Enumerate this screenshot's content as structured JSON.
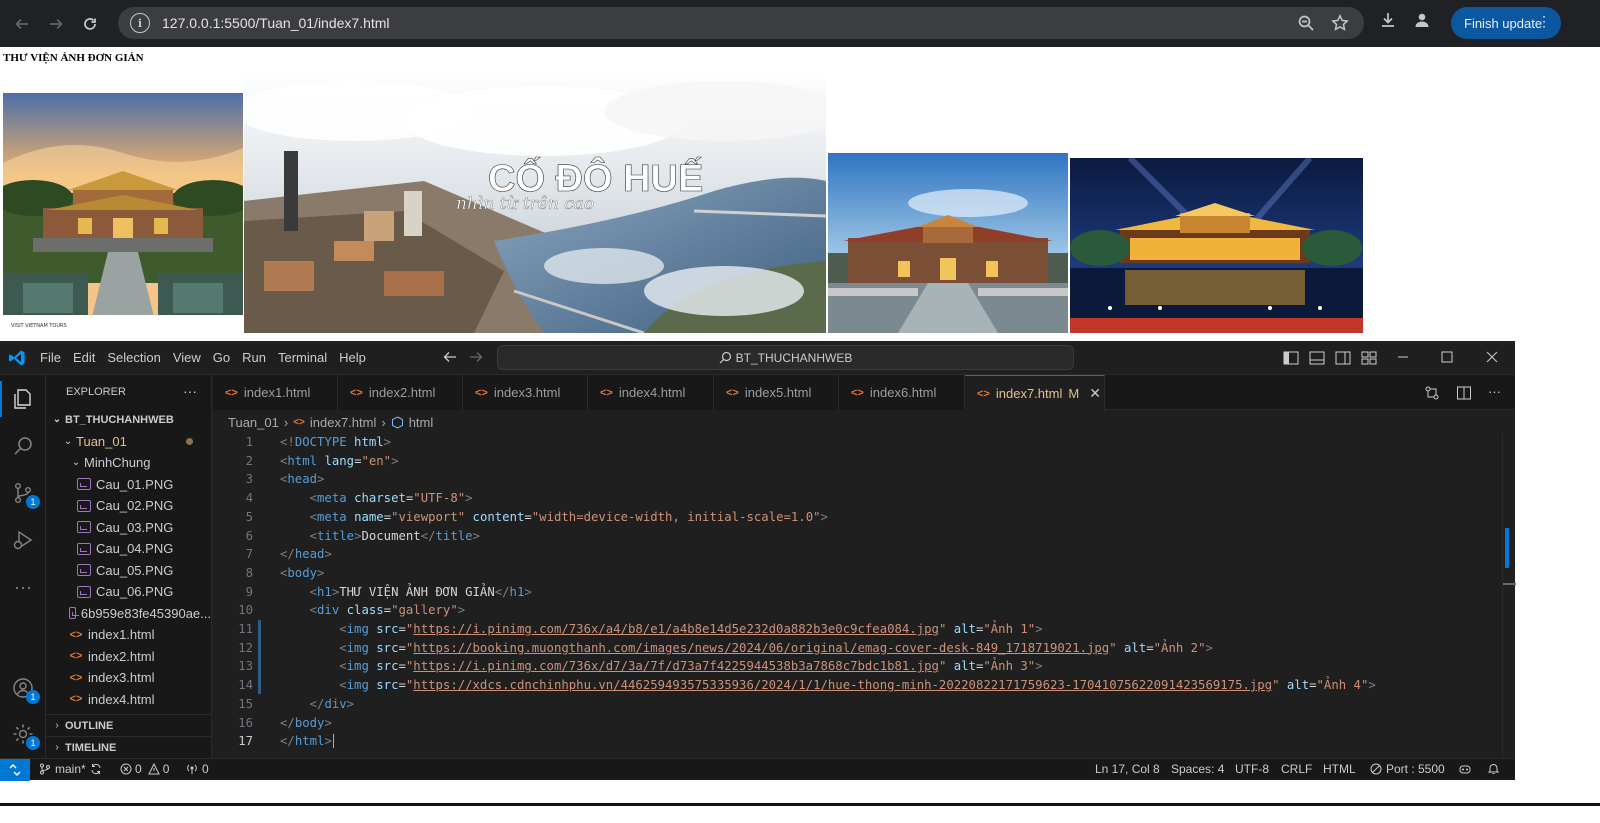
{
  "browser": {
    "url": "127.0.0.1:5500/Tuan_01/index7.html",
    "update_label": "Finish update"
  },
  "page": {
    "heading": "THƯ VIỆN ẢNH ĐƠN GIẢN",
    "image2_title": "CỐ ĐÔ HUẾ",
    "image2_subtitle": "nhìn từ trên cao",
    "image1_caption": "VISIT VIETNAM TOURS"
  },
  "vscode": {
    "menu": [
      "File",
      "Edit",
      "Selection",
      "View",
      "Go",
      "Run",
      "Terminal",
      "Help"
    ],
    "command_center": "BT_THUCHANHWEB",
    "explorer_title": "EXPLORER",
    "workspace": "BT_THUCHANHWEB",
    "tree": [
      {
        "label": "Tuan_01",
        "type": "folder"
      },
      {
        "label": "MinhChung",
        "type": "folder"
      },
      {
        "label": "Cau_01.PNG",
        "type": "png"
      },
      {
        "label": "Cau_02.PNG",
        "type": "png"
      },
      {
        "label": "Cau_03.PNG",
        "type": "png"
      },
      {
        "label": "Cau_04.PNG",
        "type": "png"
      },
      {
        "label": "Cau_05.PNG",
        "type": "png"
      },
      {
        "label": "Cau_06.PNG",
        "type": "png"
      },
      {
        "label": "6b959e83fe45390ae...",
        "type": "png"
      },
      {
        "label": "index1.html",
        "type": "html"
      },
      {
        "label": "index2.html",
        "type": "html"
      },
      {
        "label": "index3.html",
        "type": "html"
      },
      {
        "label": "index4.html",
        "type": "html"
      }
    ],
    "outline_label": "OUTLINE",
    "timeline_label": "TIMELINE",
    "tabs": [
      "index1.html",
      "index2.html",
      "index3.html",
      "index4.html",
      "index5.html",
      "index6.html",
      "index7.html"
    ],
    "active_tab_modified": "M",
    "breadcrumb": [
      "Tuan_01",
      "index7.html",
      "html"
    ],
    "badges": {
      "scm": "1",
      "accounts": "1",
      "settings": "1"
    },
    "status": {
      "branch": "main*",
      "errors": "0",
      "warnings": "0",
      "ports": "0",
      "position": "Ln 17, Col 8",
      "spaces": "Spaces: 4",
      "encoding": "UTF-8",
      "eol": "CRLF",
      "language": "HTML",
      "port": "Port : 5500"
    }
  }
}
